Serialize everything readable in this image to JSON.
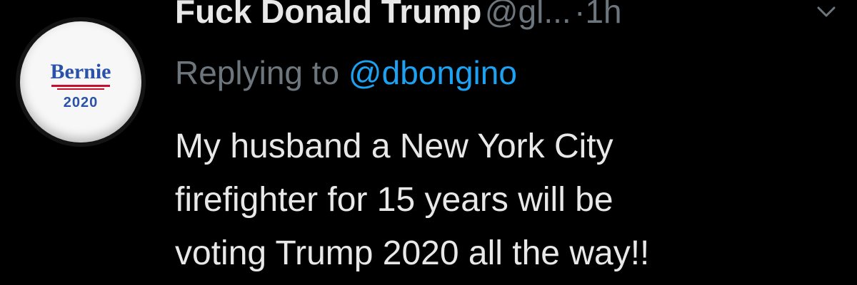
{
  "author": {
    "display_name": "Fuck Donald Trump",
    "handle": "@gl...",
    "separator": "·",
    "time": "1h",
    "avatar": {
      "name": "Bernie",
      "year": "2020",
      "accent_blue": "#2a52a8",
      "accent_red": "#c8102e"
    }
  },
  "reply": {
    "label": "Replying to",
    "handle": "@dbongino"
  },
  "tweet": {
    "lines": [
      "My husband a New York City",
      "firefighter for 15 years will be",
      "voting Trump 2020 all the way!!"
    ]
  },
  "icons": {
    "more": "chevron-down-icon"
  },
  "colors": {
    "background": "#000000",
    "text": "#e8e8e8",
    "muted": "#6e767d",
    "link": "#1da1f2"
  }
}
